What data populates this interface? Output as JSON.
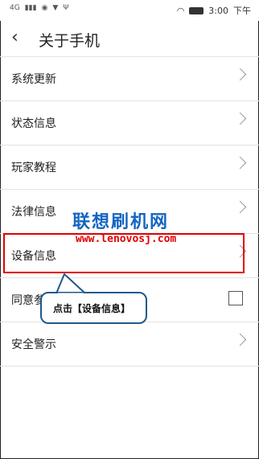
{
  "status_bar": {
    "signal_text": "4G",
    "time": "3:00",
    "ampm": "下午"
  },
  "header": {
    "title": "关于手机"
  },
  "settings": {
    "items": [
      {
        "label": "系统更新"
      },
      {
        "label": "状态信息"
      },
      {
        "label": "玩家教程"
      },
      {
        "label": "法律信息"
      },
      {
        "label": "设备信息"
      },
      {
        "label": "同意参"
      },
      {
        "label": "安全警示"
      }
    ]
  },
  "watermark": {
    "title": "联想刷机网",
    "url": "www.lenovosj.com"
  },
  "annotation": {
    "callout_text": "点击【设备信息】"
  },
  "colors": {
    "highlight": "#e00000",
    "watermark_title": "#1565c0",
    "callout_border": "#1e5a8c"
  }
}
